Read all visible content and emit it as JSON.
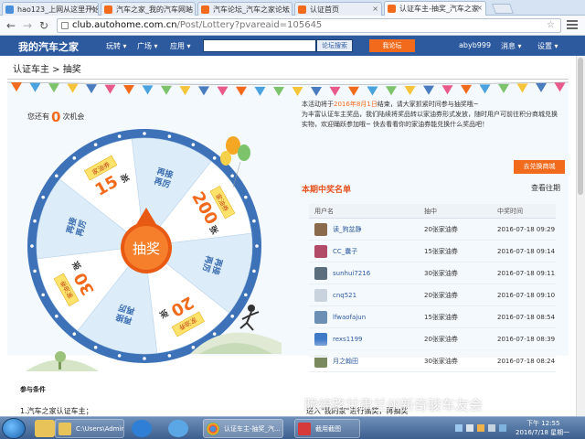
{
  "browser": {
    "tabs": [
      {
        "label": "hao123_上网从这里开始",
        "fav_color": "#4a8fd9"
      },
      {
        "label": "汽车之家_我的汽车网站",
        "fav_color": "#f26b1d"
      },
      {
        "label": "汽车论坛_汽车之家论坛",
        "fav_color": "#f26b1d"
      },
      {
        "label": "认证首页",
        "fav_color": "#f26b1d"
      },
      {
        "label": "认证车主-抽奖_汽车之家",
        "fav_color": "#f26b1d"
      }
    ],
    "url_host": "club.autohome.com.cn",
    "url_path": "/Post/Lottery?pvareaid=105645"
  },
  "site": {
    "logo": "我的汽车之家",
    "nav": [
      "玩转",
      "广场",
      "应用"
    ],
    "search_btn": "论坛搜索",
    "forum_btn": "我论坛",
    "username": "abyb999",
    "msg": "消息",
    "settings": "设置"
  },
  "page": {
    "breadcrumb": "认证车主 > 抽奖",
    "chances_prefix": "您还有",
    "chances_count": "0",
    "chances_suffix": "次机会",
    "draw_button": "抽奖",
    "intro_a": "本活动将于",
    "intro_date": "2016年8月1日",
    "intro_b": "结束，请大家抓紧时间参与抽奖哦~",
    "intro_c": "为丰富认证车主奖品，我们陆续将奖品转以家油券形式发放，随时用户可前往积分商城兑换实物，欢迎踊跃参加哦~ 快去看看你的家油券能兑换什么奖品吧！",
    "redeem_btn": "去兑换商城",
    "winners_title": "本期中奖名单",
    "history_link": "查看往期",
    "cols": [
      "用户名",
      "抽中",
      "中奖时间"
    ],
    "winners": [
      {
        "name": "读_狗盆静",
        "prize": "20张家油券",
        "time": "2016-07-18 09:29",
        "avatar": "#8a6b4c"
      },
      {
        "name": "CC_囊子",
        "prize": "15张家油券",
        "time": "2016-07-18 09:14",
        "avatar": "#b14b68"
      },
      {
        "name": "sunhui7216",
        "prize": "30张家油券",
        "time": "2016-07-18 09:11",
        "avatar": "#5a6e7d"
      },
      {
        "name": "cnq521",
        "prize": "20张家油券",
        "time": "2016-07-18 09:10",
        "avatar": "#c9d3de"
      },
      {
        "name": "lfwaofajun",
        "prize": "15张家油券",
        "time": "2016-07-18 08:54",
        "avatar": "#6b8fb5"
      },
      {
        "name": "rexs1199",
        "prize": "20张家油券",
        "time": "2016-07-18 08:39",
        "avatar": "#3f7ac7"
      },
      {
        "name": "月之翰田",
        "prize": "30张家油券",
        "time": "2016-07-18 08:24",
        "avatar": "#7a8a5e"
      }
    ],
    "conditions_title": "参与条件",
    "condition_1": "1.汽车之家认证车主；",
    "condition_2": "进入\"我的家\"进行抽奖，再抽奖"
  },
  "wheel": {
    "segments": [
      {
        "label": "再接再厉",
        "type": "retry"
      },
      {
        "label": "200张",
        "type": "prize",
        "amount": "200",
        "unit": "张"
      },
      {
        "label": "再接再厉",
        "type": "retry"
      },
      {
        "label": "20张",
        "type": "prize",
        "amount": "20",
        "unit": "张"
      },
      {
        "label": "再接再厉",
        "type": "retry"
      },
      {
        "label": "30张",
        "type": "prize",
        "amount": "30",
        "unit": "张"
      },
      {
        "label": "再接再厉",
        "type": "retry"
      },
      {
        "label": "15张",
        "type": "prize",
        "amount": "15",
        "unit": "张"
      }
    ],
    "coupon_label": "家油券",
    "colors": {
      "light": "#dcecf8",
      "white": "#ffffff",
      "rim": "#4a7dbf",
      "text": "#3a6db0",
      "orange": "#f26b1d",
      "coupon": "#fde26b"
    }
  },
  "watermark": "陇绵路甘肃兰州新奇骏车友会",
  "taskbar": {
    "explorer_task": "C:\\Users\\Admini...",
    "chrome_task": "认证车主-抽奖_汽...",
    "screenshot_task": "截用截图",
    "time": "下午 12:55",
    "date": "2016/7/18 星期一"
  },
  "colors": {
    "accent": "#f26b1d",
    "header": "#2d5a9f"
  }
}
